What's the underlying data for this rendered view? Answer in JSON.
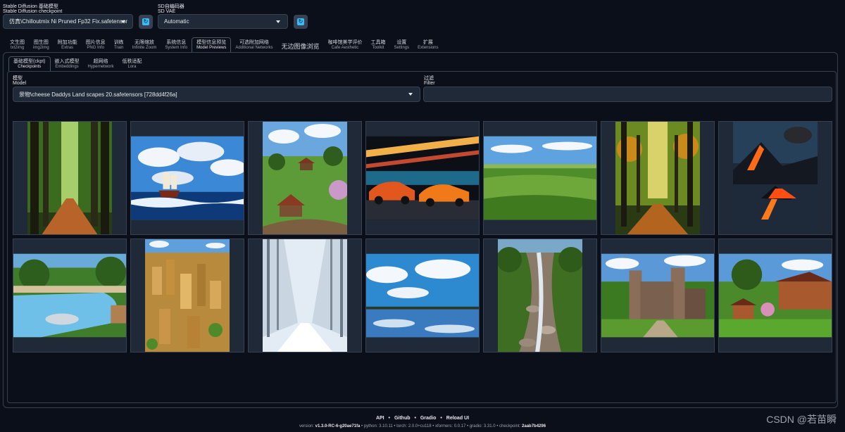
{
  "top": {
    "checkpoint_label_zh": "Stable Diffusion 基础模型",
    "checkpoint_label_en": "Stable Diffusion checkpoint",
    "checkpoint_value": "仿真\\Chilloutmix Ni Pruned Fp32 Fix.safetensor",
    "vae_label_zh": "SD自编码器",
    "vae_label_en": "SD VAE",
    "vae_value": "Automatic"
  },
  "main_tabs": [
    {
      "zh": "文生图",
      "en": "txt2img"
    },
    {
      "zh": "图生图",
      "en": "img2img"
    },
    {
      "zh": "附加功能",
      "en": "Extras"
    },
    {
      "zh": "图片信息",
      "en": "PNG Info"
    },
    {
      "zh": "训练",
      "en": "Train"
    },
    {
      "zh": "无限缩放",
      "en": "Infinite Zoom"
    },
    {
      "zh": "系统信息",
      "en": "System Info"
    },
    {
      "zh": "模型信息预览",
      "en": "Model Previews"
    },
    {
      "zh": "可选附加网络",
      "en": "Additional Networks"
    },
    {
      "zh": "无边图像浏览",
      "en": ""
    },
    {
      "zh": "咖啡馆美学评价",
      "en": "Cafe Aesthetic"
    },
    {
      "zh": "工具箱",
      "en": "Toolkit"
    },
    {
      "zh": "设置",
      "en": "Settings"
    },
    {
      "zh": "扩展",
      "en": "Extensions"
    }
  ],
  "sub_tabs": [
    {
      "zh": "基础模型(ckpt)",
      "en": "Checkpoints"
    },
    {
      "zh": "嵌入式模型",
      "en": "Embeddings"
    },
    {
      "zh": "超网络",
      "en": "Hypernetwork"
    },
    {
      "zh": "低秩适配",
      "en": "Lora"
    }
  ],
  "model": {
    "label_zh": "模型",
    "label_en": "Model",
    "value": "景物\\cheese Daddys Land scapes 20.safetensors [728dd4f26a]"
  },
  "filter": {
    "label_zh": "过滤",
    "label_en": "Filter",
    "value": ""
  },
  "gallery": [
    {
      "name": "forest-path"
    },
    {
      "name": "sailing-ship"
    },
    {
      "name": "farm-village"
    },
    {
      "name": "sports-cars"
    },
    {
      "name": "green-plains"
    },
    {
      "name": "autumn-forest"
    },
    {
      "name": "volcano"
    },
    {
      "name": "swimming-pool"
    },
    {
      "name": "city-aerial"
    },
    {
      "name": "snow-forest"
    },
    {
      "name": "lake-clouds"
    },
    {
      "name": "forest-stream"
    },
    {
      "name": "castle"
    },
    {
      "name": "house-garden"
    }
  ],
  "footer": {
    "links": [
      "API",
      "Github",
      "Gradio",
      "Reload UI"
    ],
    "version_parts": [
      {
        "label": "version:",
        "value": "v1.3.0-RC-6-g20ae71fa"
      },
      {
        "label": "python:",
        "value": "3.10.11"
      },
      {
        "label": "torch:",
        "value": "2.0.0+cu118"
      },
      {
        "label": "xformers:",
        "value": "0.0.17"
      },
      {
        "label": "gradio:",
        "value": "3.31.0"
      },
      {
        "label": "checkpoint:",
        "value": "2aab7b4296"
      }
    ]
  },
  "watermark": "CSDN @若苗瞬",
  "colors": {
    "bg": "#0b0f19",
    "input_bg": "#1f2937",
    "border": "#374151",
    "accent": "#38bdf8"
  }
}
